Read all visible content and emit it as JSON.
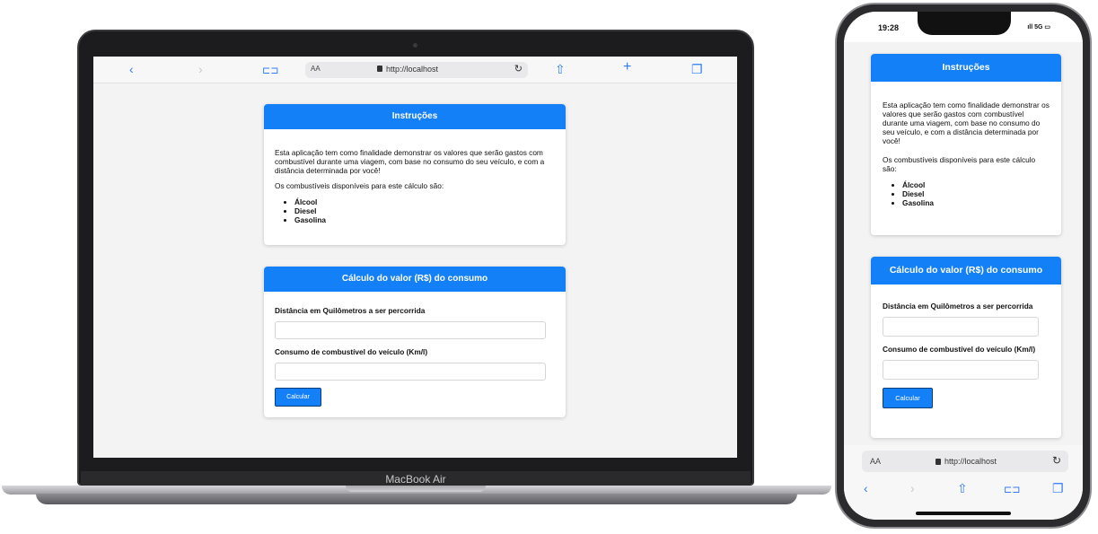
{
  "browser": {
    "url": "http://localhost",
    "aa_label": "AA",
    "back_icon": "‹",
    "forward_icon": "›",
    "bookmarks_icon": "⊏⊐",
    "share_icon": "⇧",
    "add_icon": "+",
    "tabs_icon": "❐",
    "reload_icon": "↻"
  },
  "laptop": {
    "brand": "MacBook Air"
  },
  "phone": {
    "time": "19:28",
    "signal": "ıll 5G ▭"
  },
  "instructions": {
    "title": "Instruções",
    "paragraph1": "Esta aplicação tem como finalidade demonstrar os valores que serão gastos com combustível durante uma viagem, com base no consumo do seu veículo, e com a distância determinada por você!",
    "paragraph2": "Os combustíveis disponíveis para este cálculo são:",
    "fuels": [
      "Álcool",
      "Diesel",
      "Gasolina"
    ]
  },
  "calculator": {
    "title": "Cálculo do valor (R$) do consumo",
    "distance_label": "Distância em Quilômetros a ser percorrida",
    "distance_value": "",
    "consumption_label": "Consumo de combustível do veículo (Km/l)",
    "consumption_value": "",
    "button_label": "Calcular"
  },
  "colors": {
    "accent": "#1480f8",
    "background": "#f3f3f3"
  }
}
